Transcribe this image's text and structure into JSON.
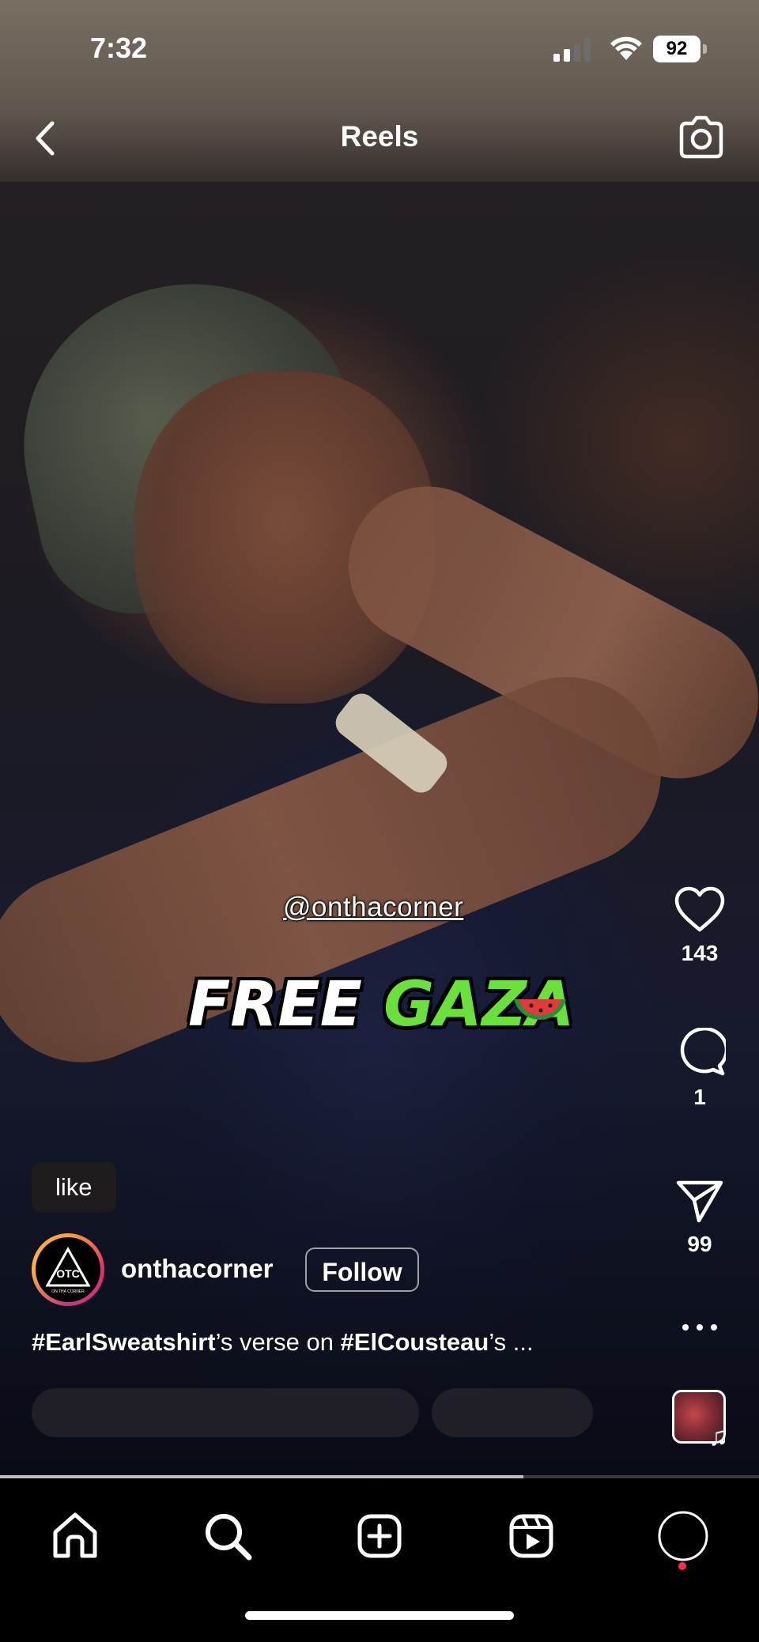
{
  "status_bar": {
    "time": "7:32",
    "battery": "92"
  },
  "header": {
    "title": "Reels",
    "back_icon": "chevron-left-icon",
    "camera_icon": "camera-icon"
  },
  "video": {
    "overlay_handle": "@onthacorner",
    "overlay_text_white": "FREE",
    "overlay_text_green": "GAZA",
    "overlay_green_color": "#6ae03c",
    "progress": 0.69
  },
  "actions": {
    "likes": "143",
    "comments": "1",
    "shares": "99"
  },
  "post": {
    "chip_label": "like",
    "username": "onthacorner",
    "follow_label": "Follow",
    "caption_tag1": "#EarlSweatshirt",
    "caption_mid": "’s verse on ",
    "caption_tag2": "#ElCousteau",
    "caption_end": "’s ...",
    "avatar_text_top": "OTC",
    "avatar_text_bottom": "ON THA CORNER"
  },
  "nav": {
    "items": [
      "home-icon",
      "search-icon",
      "create-icon",
      "reels-icon",
      "profile-icon"
    ],
    "notification_color": "#ff2d55"
  }
}
